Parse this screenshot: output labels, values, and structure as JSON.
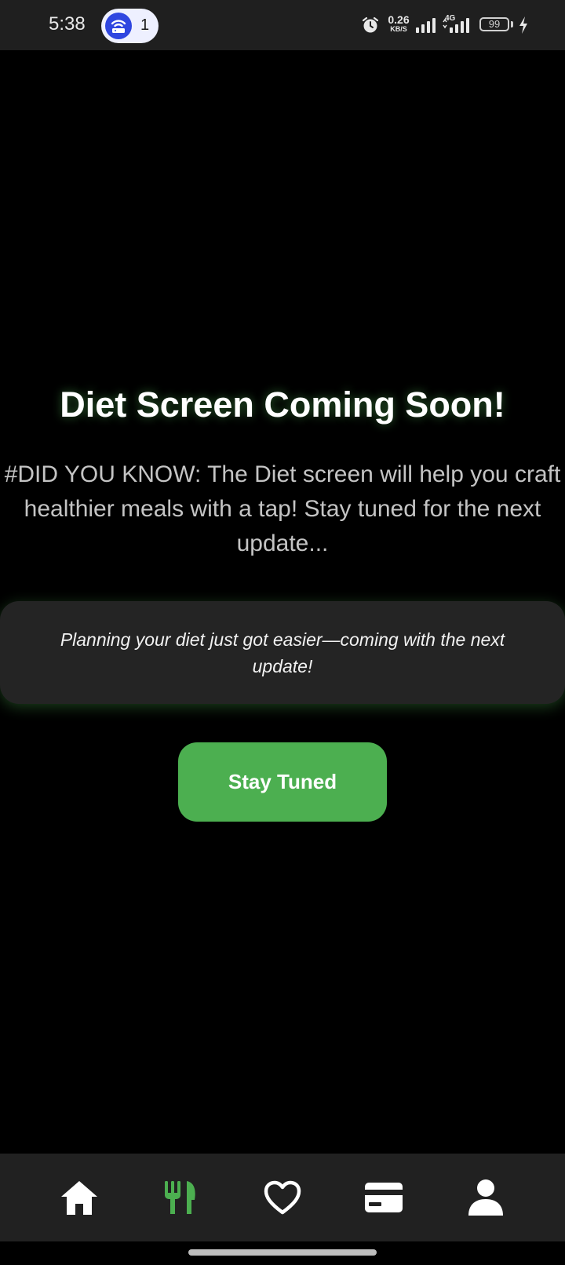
{
  "status_bar": {
    "time": "5:38",
    "hotspot_icon": "hotspot-router-icon",
    "hotspot_count": "1",
    "net_speed_value": "0.26",
    "net_speed_unit": "KB/S",
    "network_type": "4G",
    "battery_level": "99"
  },
  "main": {
    "title": "Diet Screen Coming Soon!",
    "did_you_know": "#DID YOU KNOW: The Diet screen will help you craft healthier meals with a tap! Stay tuned for the next update...",
    "card_text": "Planning your diet just got easier—coming with the next update!",
    "button_label": "Stay Tuned"
  },
  "bottom_nav": {
    "items": [
      {
        "icon": "home-icon",
        "active": false
      },
      {
        "icon": "fork-knife-icon",
        "active": true
      },
      {
        "icon": "heart-icon",
        "active": false
      },
      {
        "icon": "credit-card-icon",
        "active": false
      },
      {
        "icon": "person-icon",
        "active": false
      }
    ]
  },
  "colors": {
    "accent": "#4caf50",
    "background": "#000000",
    "card": "#242424",
    "nav_bar": "#212121",
    "status_bar": "#1f1f1f",
    "hotspot": "#2f46e0"
  }
}
